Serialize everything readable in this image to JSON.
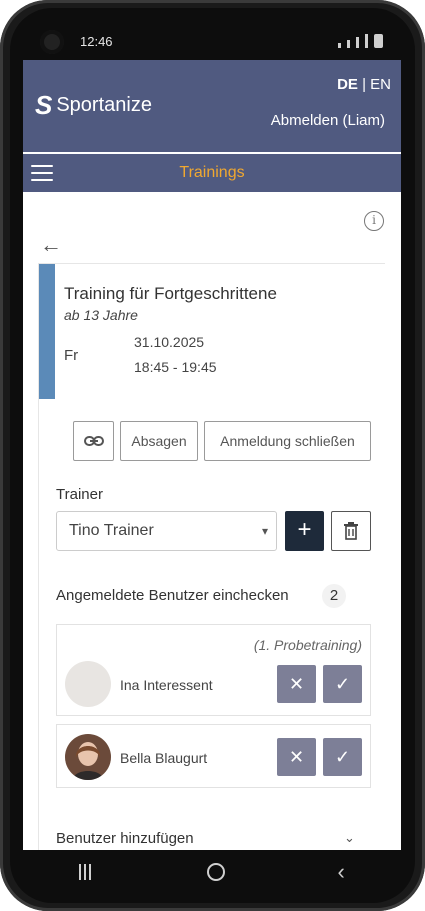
{
  "status": {
    "time": "12:46"
  },
  "header": {
    "logo_mark": "S",
    "logo_text": "Sportanize",
    "lang_active": "DE",
    "lang_sep": "|",
    "lang_other": "EN",
    "logout": "Abmelden (Liam)"
  },
  "nav": {
    "title": "Trainings"
  },
  "training": {
    "title": "Training für Fortgeschrittene",
    "subtitle": "ab 13 Jahre",
    "weekday": "Fr",
    "date": "31.10.2025",
    "time": "18:45 - 19:45"
  },
  "actions": {
    "cancel": "Absagen",
    "close_registration": "Anmeldung schließen"
  },
  "trainer": {
    "label": "Trainer",
    "selected": "Tino Trainer",
    "add": "+"
  },
  "checkin": {
    "label": "Angemeldete Benutzer einchecken",
    "count": "2",
    "users": [
      {
        "name": "Ina Interessent",
        "note": "(1. Probetraining)"
      },
      {
        "name": "Bella Blaugurt",
        "note": ""
      }
    ]
  },
  "add_users": {
    "label": "Benutzer hinzufügen"
  },
  "colors": {
    "header_bg": "#505a80",
    "accent_orange": "#f0a830",
    "card_accent": "#5b8ab8",
    "action_buttons": "#7d7f97",
    "add_button": "#1e2a3a"
  }
}
